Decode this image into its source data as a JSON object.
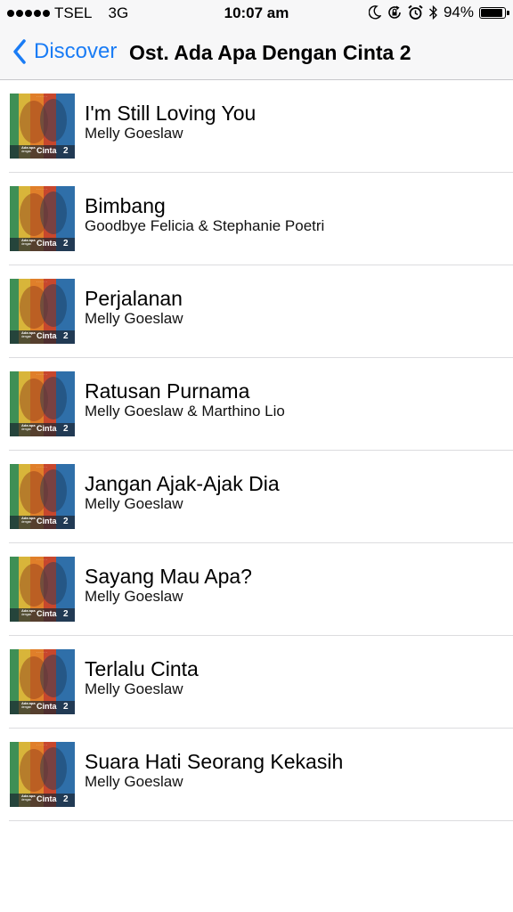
{
  "status_bar": {
    "carrier": "TSEL",
    "network": "3G",
    "time": "10:07 am",
    "battery": "94%",
    "battery_level": 0.94
  },
  "nav": {
    "back_label": "Discover",
    "title": "Ost. Ada Apa Dengan Cinta 2"
  },
  "album_art": {
    "top_text": "· · · · · ·",
    "text_small": "Ada apa",
    "text_small2": "dengan",
    "text_big": "Cinta",
    "text_num": "2"
  },
  "tracks": [
    {
      "title": "I'm Still Loving You",
      "artist": "Melly Goeslaw"
    },
    {
      "title": "Bimbang",
      "artist": "Goodbye Felicia & Stephanie Poetri"
    },
    {
      "title": "Perjalanan",
      "artist": "Melly Goeslaw"
    },
    {
      "title": "Ratusan Purnama",
      "artist": "Melly Goeslaw & Marthino Lio"
    },
    {
      "title": "Jangan Ajak-Ajak Dia",
      "artist": "Melly Goeslaw"
    },
    {
      "title": "Sayang Mau Apa?",
      "artist": "Melly Goeslaw"
    },
    {
      "title": "Terlalu Cinta",
      "artist": "Melly Goeslaw"
    },
    {
      "title": "Suara Hati Seorang Kekasih",
      "artist": "Melly Goeslaw"
    }
  ],
  "colors": {
    "accent": "#1a7cf5",
    "separator": "#dcdcdf",
    "nav_background": "#f7f7f8"
  }
}
